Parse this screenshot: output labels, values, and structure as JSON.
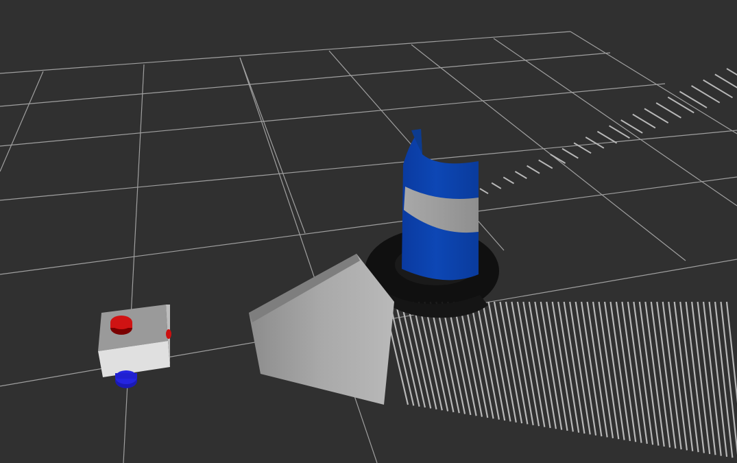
{
  "scene": {
    "background_color": "#303030",
    "grid_color": "#a0a0a0",
    "objects": [
      {
        "name": "robot",
        "body_color": "#dedede",
        "top_color": "#9a9a9a",
        "sensor_color": "#cc1010",
        "wheel_color": "#2020dd"
      },
      {
        "name": "cylinder-obstacle",
        "color": "#0a3fa8",
        "band_color": "#9a9a9a"
      },
      {
        "name": "laser-scan",
        "color": "#b8b8b8"
      },
      {
        "name": "scan-shadow",
        "color": "#101010"
      }
    ]
  }
}
